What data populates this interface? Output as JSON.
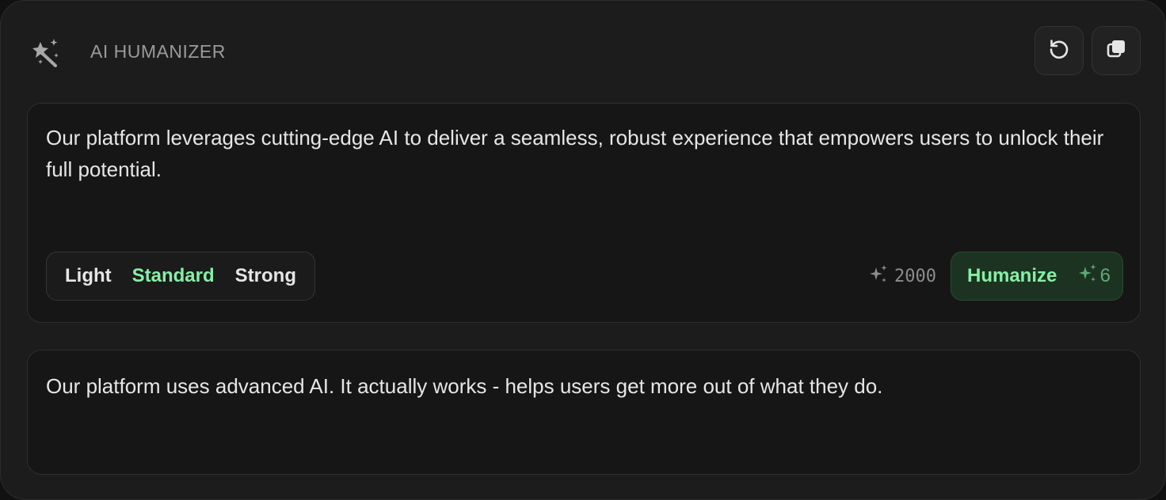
{
  "header": {
    "title": "AI HUMANIZER",
    "icon": "magic-wand-icon",
    "actions": [
      {
        "name": "reset",
        "icon": "rotate-ccw-icon"
      },
      {
        "name": "copy",
        "icon": "copy-icon"
      }
    ]
  },
  "input": {
    "text": "Our platform leverages cutting-edge AI to deliver a seamless, robust experience that empowers users to unlock their full potential."
  },
  "modes": {
    "options": [
      "Light",
      "Standard",
      "Strong"
    ],
    "selected": "Standard"
  },
  "credits": {
    "icon": "sparkles-icon",
    "balance": "2000"
  },
  "humanize_button": {
    "label": "Humanize",
    "cost": "6",
    "cost_icon": "sparkles-icon"
  },
  "output": {
    "text": "Our platform uses advanced AI. It actually works - helps users get more out of what they do."
  },
  "colors": {
    "background": "#1c1c1c",
    "panel": "#161616",
    "accent": "#86efa5",
    "accent_bg": "#1c3322",
    "muted": "#9a9a9a"
  }
}
